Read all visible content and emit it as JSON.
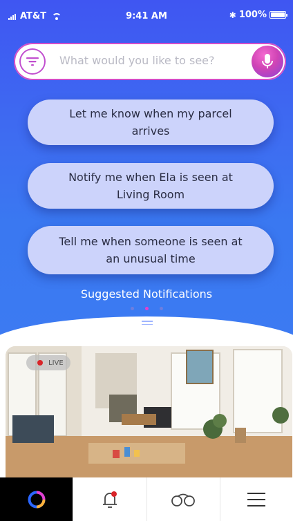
{
  "status": {
    "carrier": "AT&T",
    "time": "9:41 AM",
    "battery": "100%"
  },
  "search": {
    "placeholder": "What would you like to see?"
  },
  "suggestions": [
    {
      "line1": "Let me know when my parcel",
      "line2": "arrives"
    },
    {
      "line1": "Notify me when Ela is seen at",
      "line2": "Living Room"
    },
    {
      "line1": "Tell me when someone is seen at",
      "line2": "an unusual time"
    }
  ],
  "suggested_label": "Suggested Notifications",
  "pagination": {
    "pages": 3,
    "active": 2
  },
  "camera": {
    "live_label": "LIVE"
  },
  "tabs": [
    "home",
    "notifications",
    "views",
    "menu"
  ],
  "colors": {
    "accent": "#d04cc9",
    "primary_bg": "#3e6cf1",
    "pill_bg": "#ccd3fb",
    "live": "#d9252a"
  }
}
